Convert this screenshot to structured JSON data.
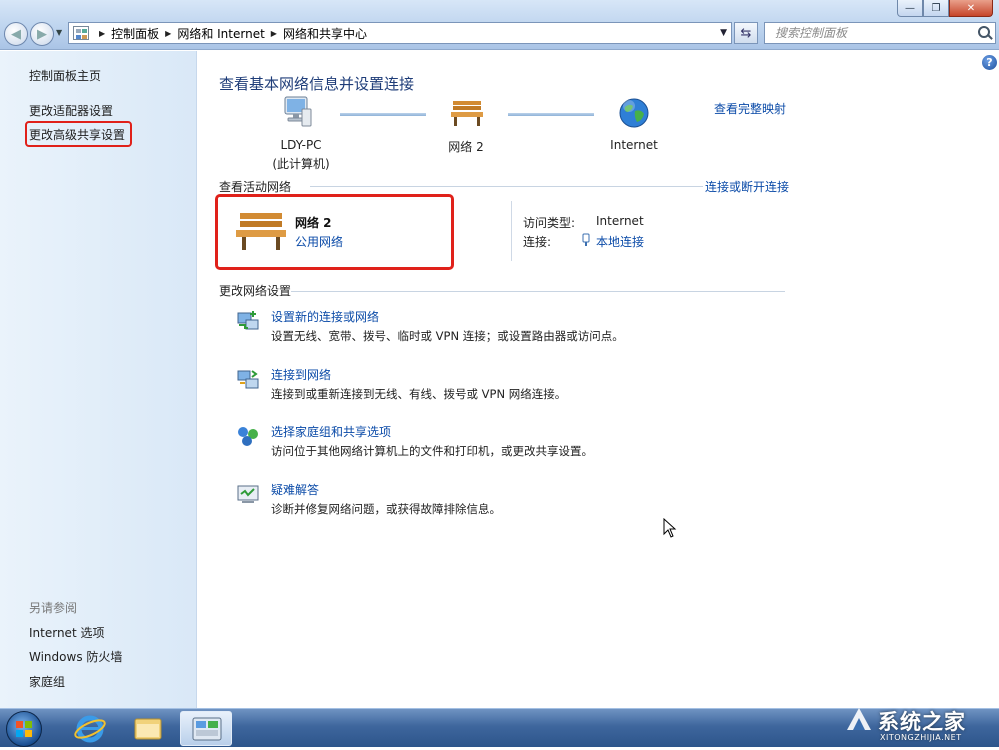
{
  "window": {
    "controls": {
      "minimize": "—",
      "maximize": "❐",
      "close": "✕"
    }
  },
  "address_bar": {
    "crumbs": [
      "控制面板",
      "网络和 Internet",
      "网络和共享中心"
    ],
    "search_placeholder": "搜索控制面板"
  },
  "left_pane": {
    "home": "控制面板主页",
    "links": [
      "更改适配器设置",
      "更改高级共享设置"
    ],
    "see_also_heading": "另请参阅",
    "see_also": [
      "Internet 选项",
      "Windows 防火墙",
      "家庭组"
    ]
  },
  "main": {
    "title": "查看基本网络信息并设置连接",
    "view_full_map": "查看完整映射",
    "map": {
      "computer_name": "LDY-PC",
      "computer_sub": "(此计算机)",
      "network": "网络  2",
      "internet": "Internet"
    },
    "active_networks": {
      "heading": "查看活动网络",
      "connect_disconnect": "连接或断开连接",
      "network_name": "网络  2",
      "network_type": "公用网络",
      "access_type_label": "访问类型:",
      "access_type_value": "Internet",
      "connections_label": "连接:",
      "connections_value": "本地连接"
    },
    "change_settings": {
      "heading": "更改网络设置",
      "tasks": [
        {
          "title": "设置新的连接或网络",
          "desc": "设置无线、宽带、拨号、临时或 VPN 连接；或设置路由器或访问点。"
        },
        {
          "title": "连接到网络",
          "desc": "连接到或重新连接到无线、有线、拨号或 VPN 网络连接。"
        },
        {
          "title": "选择家庭组和共享选项",
          "desc": "访问位于其他网络计算机上的文件和打印机，或更改共享设置。"
        },
        {
          "title": "疑难解答",
          "desc": "诊断并修复网络问题，或获得故障排除信息。"
        }
      ]
    }
  },
  "watermark": {
    "text": "系统之家",
    "sub": "XITONGZHIJIA.NET"
  },
  "colors": {
    "link": "#0b4ba8",
    "title": "#1e3c78",
    "highlight": "#e0211a"
  }
}
